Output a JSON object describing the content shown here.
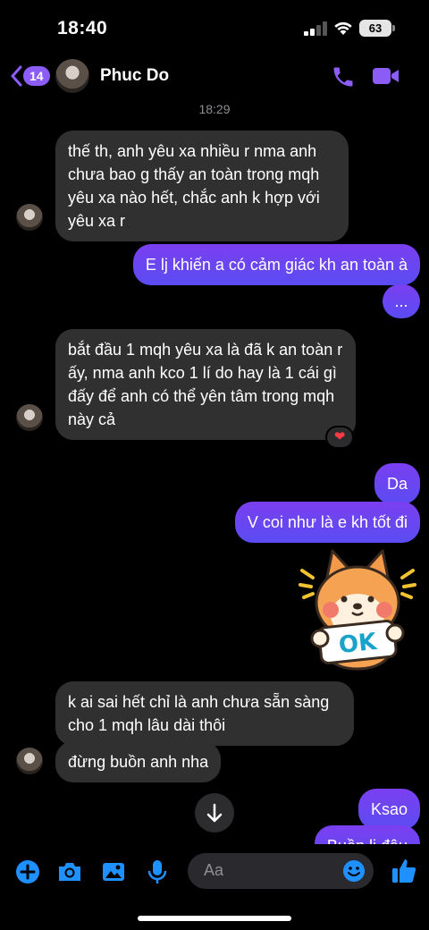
{
  "status_bar": {
    "time": "18:40",
    "battery": "63"
  },
  "header": {
    "back_badge": "14",
    "contact_name": "Phuc Do"
  },
  "timestamp": "18:29",
  "messages": [
    {
      "dir": "in",
      "text": "thế th, anh yêu xa nhiều r nma anh chưa bao g thấy an toàn trong mqh yêu xa nào hết, chắc anh k hợp với yêu xa r"
    },
    {
      "dir": "out",
      "text": "E lj khiến a có cảm giác kh an toàn à"
    },
    {
      "dir": "out",
      "text": "..."
    },
    {
      "dir": "in",
      "text": "bắt đầu 1 mqh yêu xa là đã k an toàn r ấy, nma anh kco 1 lí do hay là 1 cái gì đấy để anh có thể yên tâm trong mqh này cả",
      "reaction": "❤"
    },
    {
      "dir": "out",
      "text": "Da"
    },
    {
      "dir": "out",
      "text": "V coi như là e kh tốt đi"
    },
    {
      "dir": "out",
      "sticker": "shiba-ok-sticker",
      "sticker_text": "OK"
    },
    {
      "dir": "in",
      "text": "k ai sai hết chỉ là anh chưa sẵn sàng cho 1 mqh lâu dài thôi"
    },
    {
      "dir": "in",
      "text": "đừng buồn anh nha"
    },
    {
      "dir": "out",
      "text": "Ksao"
    },
    {
      "dir": "out",
      "text": "Buồn lj đâu"
    }
  ],
  "composer": {
    "placeholder": "Aa"
  },
  "colors": {
    "accent": "#8b5cf6",
    "incoming_bubble": "#303030",
    "outgoing_bubble": "#6b46f0",
    "icon_blue": "#1e90ff"
  },
  "icons": [
    "back-chevron-icon",
    "phone-icon",
    "video-icon",
    "chevron-down-icon",
    "plus-icon",
    "camera-icon",
    "image-icon",
    "microphone-icon",
    "emoji-icon",
    "thumbs-up-icon"
  ]
}
